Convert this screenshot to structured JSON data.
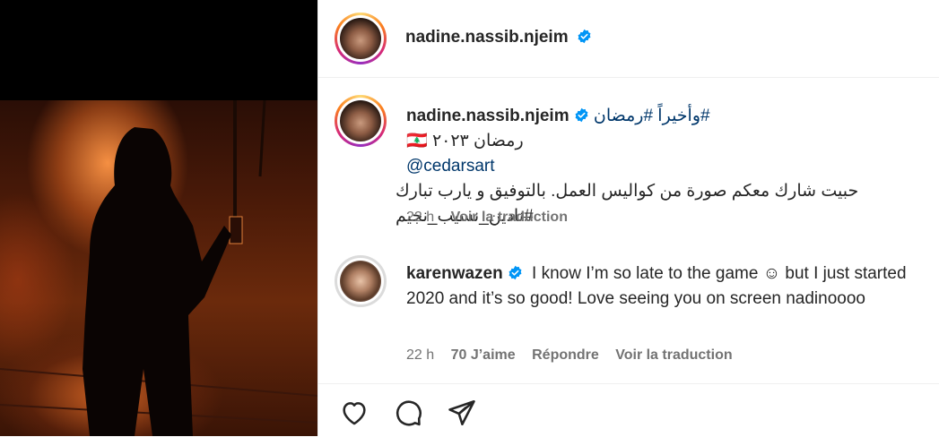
{
  "post": {
    "author": "nadine.nassib.njeim"
  },
  "caption": {
    "username": "nadine.nassib.njeim",
    "line1_hashtags": "وأخيراً #رمضان#",
    "line2": "🇱🇧 رمضان ٢٠٢٣",
    "mention": "@cedarsart",
    "line4": "حبيت شارك معكم صورة من كواليس العمل. بالتوفيق و يارب تبارك #نادين_نسيب_نجيم",
    "time": "22 h",
    "translate": "Voir la traduction"
  },
  "comment": {
    "username": "karenwazen",
    "text": "I know I’m so late to the game ☺︎ but I just started 2020 and it’s so good! Love seeing you on screen nadinoooo",
    "time": "22 h",
    "likes": "70 J’aime",
    "reply": "Répondre",
    "translate": "Voir la traduction"
  },
  "icons": [
    "heart-icon",
    "comment-icon",
    "share-icon",
    "verified-badge-icon"
  ],
  "colors": {
    "verified": "#0095f6",
    "hashtag": "#00376b",
    "meta": "#737373"
  }
}
